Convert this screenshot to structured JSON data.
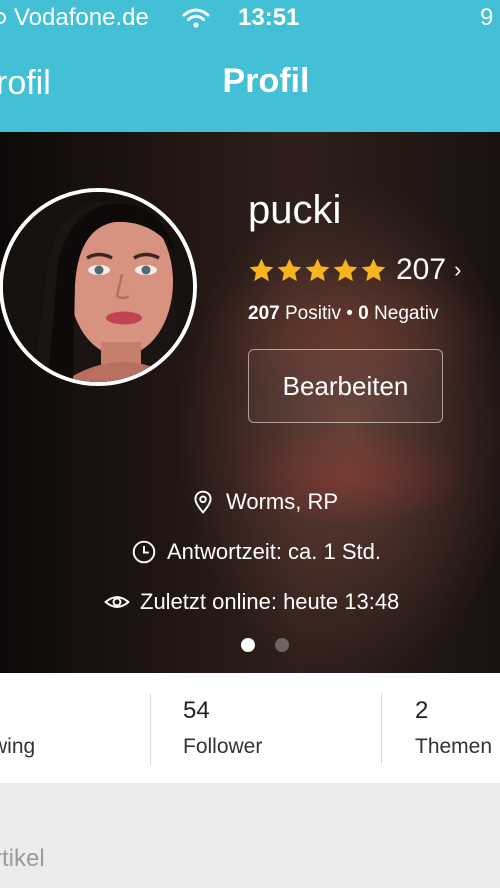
{
  "status_bar": {
    "carrier": "Vodafone.de",
    "time": "13:51",
    "battery": "9"
  },
  "nav": {
    "back_label": "rofil",
    "title": "Profil"
  },
  "profile": {
    "username": "pucki",
    "rating": 5,
    "rating_count": "207",
    "rating_chevron": "›",
    "positive_count": "207",
    "positive_label": "Positiv",
    "separator": "•",
    "negative_count": "0",
    "negative_label": "Negativ",
    "edit_label": "Bearbeiten",
    "location": "Worms, RP",
    "response_time": "Antwortzeit: ca. 1 Std.",
    "last_online": "Zuletzt online: heute 13:48",
    "carousel_active": 1,
    "carousel_total": 2
  },
  "stats": [
    {
      "number": "",
      "label": "wing"
    },
    {
      "number": "54",
      "label": "Follower"
    },
    {
      "number": "2",
      "label": "Themen"
    }
  ],
  "section": {
    "title": "rtikel"
  },
  "colors": {
    "header": "#43bfd6",
    "star": "#f7b41d",
    "background": "#ececee"
  },
  "icons": [
    "wifi-icon",
    "star-icon",
    "location-pin-icon",
    "clock-icon",
    "eye-icon"
  ]
}
